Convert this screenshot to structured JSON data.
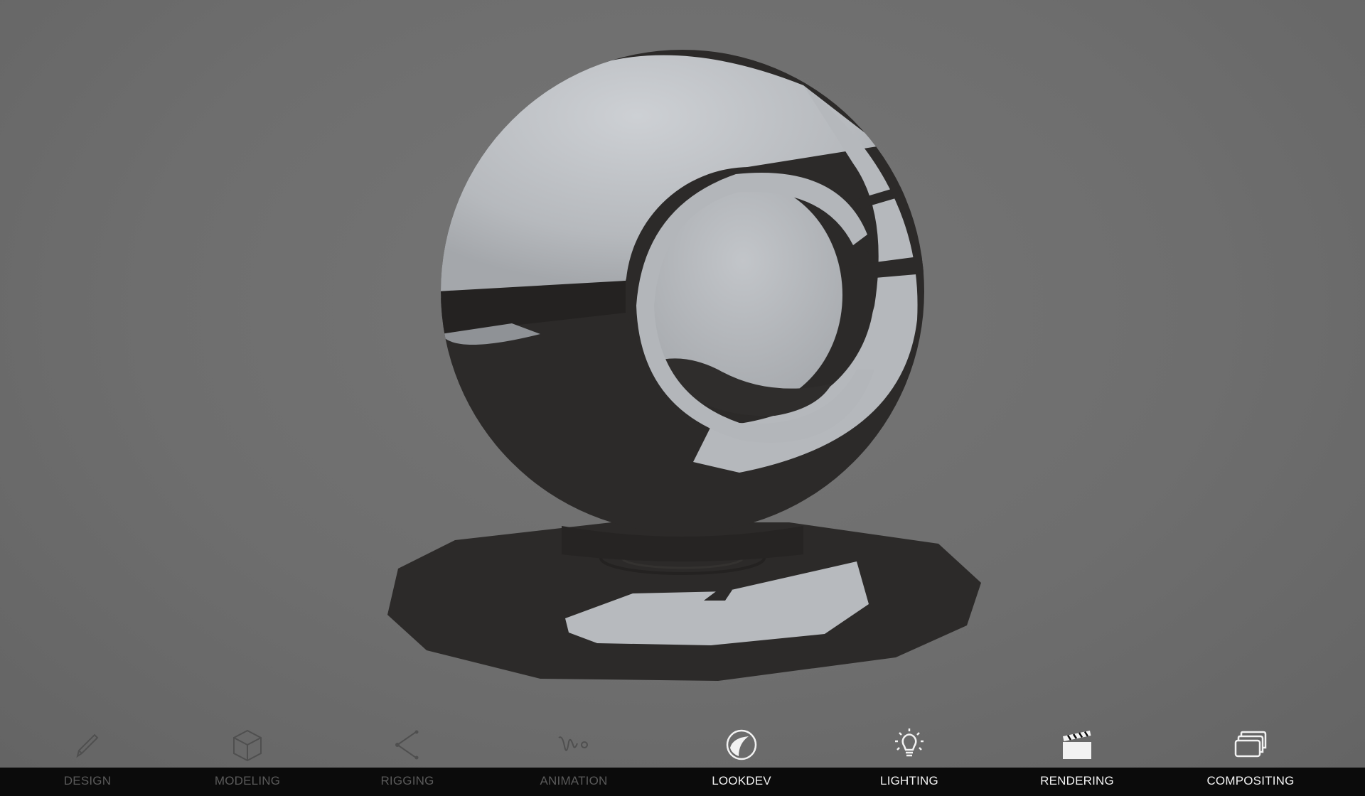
{
  "pipeline": {
    "stages": [
      {
        "label": "DESIGN",
        "icon": "pencil-icon",
        "active": false
      },
      {
        "label": "MODELING",
        "icon": "cube-icon",
        "active": false
      },
      {
        "label": "RIGGING",
        "icon": "bone-joint-icon",
        "active": false
      },
      {
        "label": "ANIMATION",
        "icon": "motion-path-icon",
        "active": false
      },
      {
        "label": "LOOKDEV",
        "icon": "shaded-sphere-icon",
        "active": true
      },
      {
        "label": "LIGHTING",
        "icon": "light-bulb-icon",
        "active": true
      },
      {
        "label": "RENDERING",
        "icon": "clapperboard-icon",
        "active": true
      },
      {
        "label": "COMPOSITING",
        "icon": "stacked-layers-icon",
        "active": true
      }
    ]
  },
  "colors": {
    "viewport_background": "#6e6e6e",
    "label_strip": "#0b0b0b",
    "active_label": "#f2f2f2",
    "inactive_label": "#5a5a5a",
    "material_light": "#b9bcc0",
    "material_dark": "#2c2a29"
  }
}
